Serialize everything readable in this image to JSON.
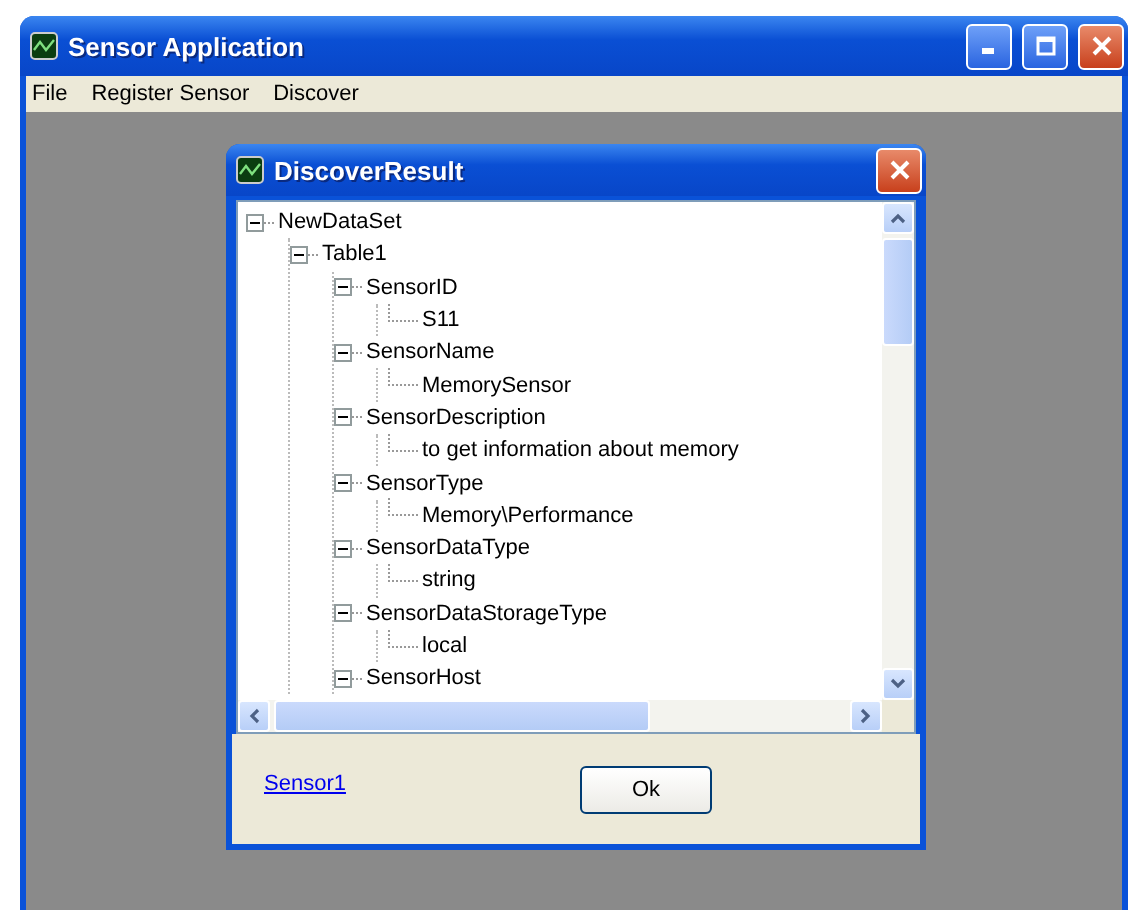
{
  "window": {
    "title": "Sensor Application"
  },
  "menu": [
    "File",
    "Register Sensor",
    "Discover"
  ],
  "dialog": {
    "title": "DiscoverResult",
    "tree": [
      {
        "label": "NewDataSet",
        "expanded": true,
        "children": [
          {
            "label": "Table1",
            "expanded": true,
            "children": [
              {
                "label": "SensorID",
                "expanded": true,
                "children": [
                  {
                    "label": "S11"
                  }
                ]
              },
              {
                "label": "SensorName",
                "expanded": true,
                "children": [
                  {
                    "label": "MemorySensor"
                  }
                ]
              },
              {
                "label": "SensorDescription",
                "expanded": true,
                "children": [
                  {
                    "label": "to get information about memory"
                  }
                ]
              },
              {
                "label": "SensorType",
                "expanded": true,
                "children": [
                  {
                    "label": "Memory\\Performance"
                  }
                ]
              },
              {
                "label": "SensorDataType",
                "expanded": true,
                "children": [
                  {
                    "label": "string"
                  }
                ]
              },
              {
                "label": "SensorDataStorageType",
                "expanded": true,
                "children": [
                  {
                    "label": "local"
                  }
                ]
              },
              {
                "label": "SensorHost",
                "expanded": true
              }
            ]
          }
        ]
      }
    ],
    "link": "Sensor1",
    "button": "Ok"
  }
}
